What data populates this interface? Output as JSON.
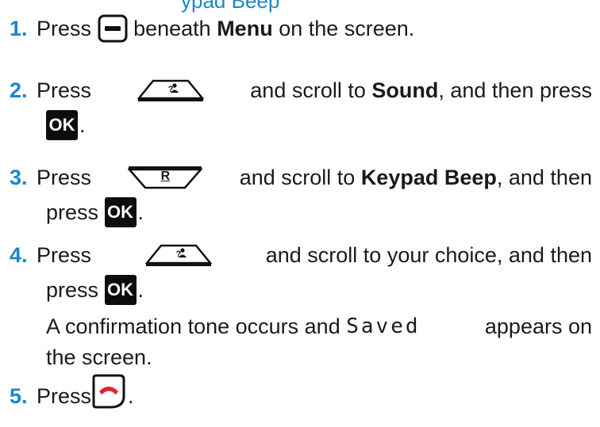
{
  "heading_fragment": "ypad Beep",
  "steps": [
    {
      "num": "1.",
      "a": "Press",
      "b": "beneath",
      "c": "Menu",
      "d": "on the screen."
    },
    {
      "num": "2.",
      "a": "Press",
      "b": "and scroll to",
      "c": "Sound",
      "d": ", and then press",
      "end": "."
    },
    {
      "num": "3.",
      "a": "Press",
      "key_label": "R",
      "b": "and scroll to",
      "c": "Keypad Beep",
      "d": ", and then",
      "e": "press",
      "end": "."
    },
    {
      "num": "4.",
      "a": "Press",
      "b": "and scroll to your choice, and then",
      "e": "press",
      "end": ".",
      "note_a": "A confirmation tone occurs and",
      "note_saved": "Saved",
      "note_b": "appears on",
      "note_c": "the screen."
    },
    {
      "num": "5.",
      "a": "Press",
      "end": "."
    }
  ],
  "ok_label": "OK",
  "icons": {
    "menu_key": "soft-key-icon",
    "nav_up": "nav-up-phonebook-icon",
    "nav_down": "nav-down-redial-icon",
    "ok": "ok-key-icon",
    "end": "end-call-icon"
  },
  "colors": {
    "step_number": "#1b86c9",
    "end_call_red": "#e0252b",
    "ok_key_bg": "#0d0d0d"
  }
}
